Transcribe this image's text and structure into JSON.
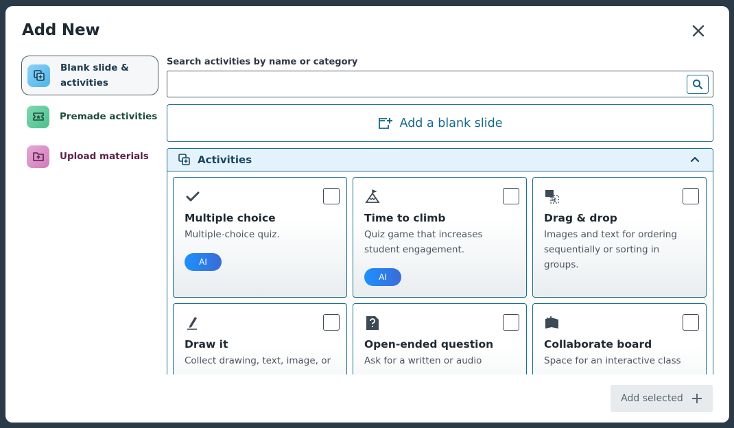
{
  "dialog": {
    "title": "Add New"
  },
  "sidebar": {
    "items": [
      {
        "label": "Blank slide & activities",
        "icon": "duplicate-slide-icon",
        "color": "#4fb3ea",
        "active": true
      },
      {
        "label": "Premade activities",
        "icon": "ticket-icon",
        "color": "#4cbf8d",
        "active": false
      },
      {
        "label": "Upload materials",
        "icon": "folder-upload-icon",
        "color": "#cf7bbb",
        "active": false
      }
    ]
  },
  "search": {
    "label": "Search activities by name or category",
    "value": "",
    "placeholder": ""
  },
  "blank_slide": {
    "label": "Add a blank slide"
  },
  "activities": {
    "header": "Activities",
    "expanded": true,
    "cards": [
      {
        "title": "Multiple choice",
        "description": "Multiple-choice quiz.",
        "icon": "checkmark-icon",
        "badge": "AI",
        "checked": false
      },
      {
        "title": "Time to climb",
        "description": "Quiz game that increases student engagement.",
        "icon": "mountain-flag-icon",
        "badge": "AI",
        "checked": false
      },
      {
        "title": "Drag & drop",
        "description": "Images and text for ordering sequentially or sorting in groups.",
        "icon": "drag-drop-icon",
        "badge": "",
        "checked": false
      },
      {
        "title": "Draw it",
        "description": "Collect drawing, text, image, or",
        "icon": "pencil-icon",
        "badge": "",
        "checked": false
      },
      {
        "title": "Open-ended question",
        "description": "Ask for a written or audio",
        "icon": "question-doc-icon",
        "badge": "",
        "checked": false
      },
      {
        "title": "Collaborate board",
        "description": "Space for an interactive class",
        "icon": "board-icon",
        "badge": "",
        "checked": false
      }
    ]
  },
  "footer": {
    "add_selected_label": "Add selected"
  },
  "colors": {
    "accent": "#1a6e8e",
    "backdrop": "#2b3a47",
    "header_bg": "#e4f3fb"
  }
}
